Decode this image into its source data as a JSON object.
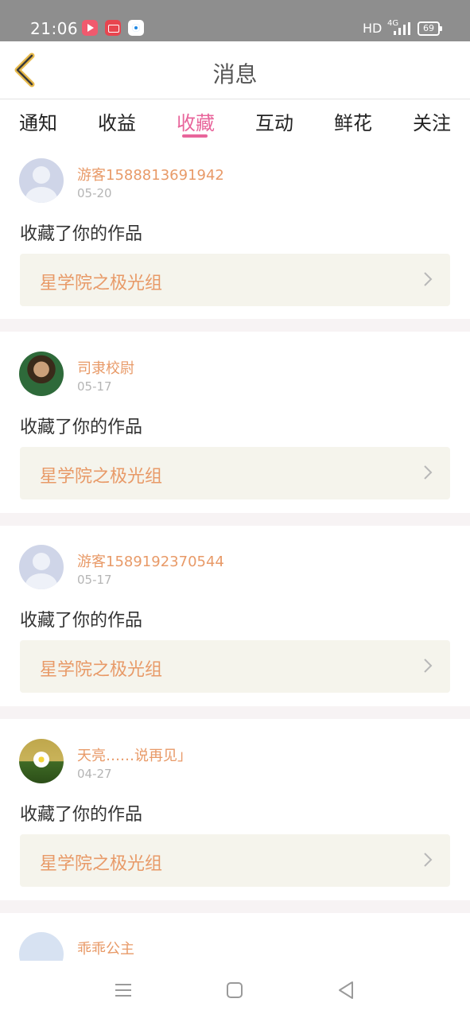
{
  "status": {
    "time": "21:06",
    "network": "HD",
    "net_type": "4G",
    "battery": "69"
  },
  "header": {
    "title": "消息",
    "back_icon": "chevron-left-icon"
  },
  "tabs": [
    {
      "label": "通知"
    },
    {
      "label": "收益"
    },
    {
      "label": "收藏",
      "active": true
    },
    {
      "label": "互动"
    },
    {
      "label": "鲜花"
    },
    {
      "label": "关注"
    }
  ],
  "colors": {
    "accent": "#e8659b",
    "username": "#e89a68",
    "card_bg": "#f5f4ec"
  },
  "feed": [
    {
      "username": "游客1588813691942",
      "date": "05-20",
      "action": "收藏了你的作品",
      "work_title": "星学院之极光组"
    },
    {
      "username": "司隶校尉",
      "date": "05-17",
      "action": "收藏了你的作品",
      "work_title": "星学院之极光组"
    },
    {
      "username": "游客1589192370544",
      "date": "05-17",
      "action": "收藏了你的作品",
      "work_title": "星学院之极光组"
    },
    {
      "username": "天亮……说再见」",
      "date": "04-27",
      "action": "收藏了你的作品",
      "work_title": "星学院之极光组"
    },
    {
      "username": "乖乖公主"
    }
  ]
}
